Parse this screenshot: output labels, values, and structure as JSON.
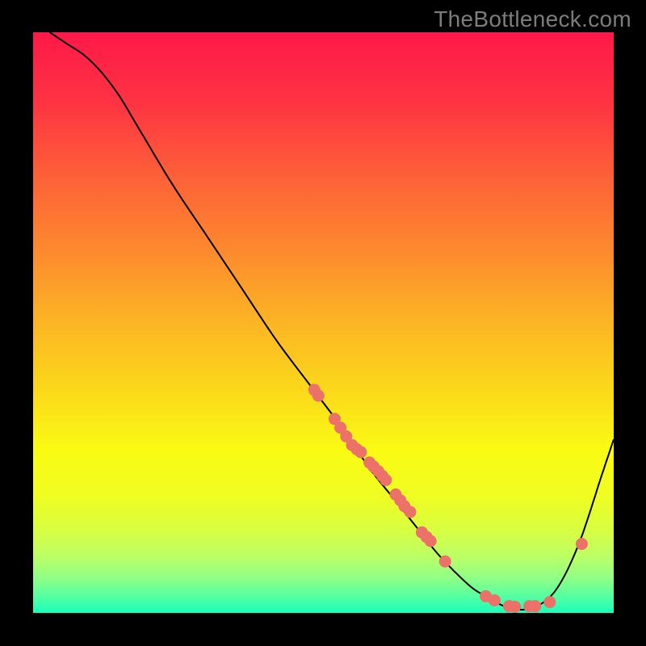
{
  "watermark": "TheBottleneck.com",
  "colors": {
    "curve": "#000000",
    "points": "#ec7168",
    "axis": "#000000"
  },
  "chart_data": {
    "type": "line",
    "title": "",
    "xlabel": "",
    "ylabel": "",
    "xlim": [
      0,
      100
    ],
    "ylim": [
      0,
      100
    ],
    "grid": false,
    "legend": false,
    "curve": {
      "x": [
        3,
        6,
        9,
        12,
        15,
        18,
        24,
        30,
        36,
        42,
        48,
        54,
        58,
        62,
        66,
        70,
        75,
        78,
        82,
        86,
        90,
        94,
        98,
        100
      ],
      "y": [
        100,
        98,
        96,
        93,
        89,
        84,
        74,
        65,
        56,
        47,
        39,
        31,
        25,
        20,
        15,
        10,
        5,
        3,
        1,
        1,
        4,
        12,
        24,
        30
      ]
    },
    "points": {
      "x": [
        48.5,
        49.2,
        52.0,
        53.0,
        54.0,
        55.0,
        55.8,
        56.5,
        58.0,
        58.7,
        59.5,
        60.2,
        60.8,
        62.5,
        63.3,
        64.0,
        65.0,
        67.0,
        67.8,
        68.5,
        71.0,
        78.0,
        79.5,
        82.0,
        83.0,
        85.5,
        86.5,
        89.0,
        94.5
      ],
      "y": [
        38.5,
        37.5,
        33.5,
        32.0,
        30.5,
        29.0,
        28.3,
        27.8,
        26.0,
        25.3,
        24.5,
        23.7,
        23.0,
        20.5,
        19.5,
        18.5,
        17.5,
        14.0,
        13.2,
        12.5,
        9.0,
        3.0,
        2.3,
        1.3,
        1.2,
        1.3,
        1.3,
        2.0,
        12.0
      ]
    },
    "background_gradient": {
      "type": "vertical",
      "stops": [
        {
          "pos": 0.0,
          "color": "#fe1948"
        },
        {
          "pos": 0.12,
          "color": "#fe3343"
        },
        {
          "pos": 0.25,
          "color": "#fd6138"
        },
        {
          "pos": 0.38,
          "color": "#fd8b2e"
        },
        {
          "pos": 0.5,
          "color": "#fcb524"
        },
        {
          "pos": 0.62,
          "color": "#fbda1a"
        },
        {
          "pos": 0.72,
          "color": "#fafb13"
        },
        {
          "pos": 0.8,
          "color": "#effd22"
        },
        {
          "pos": 0.86,
          "color": "#d6fe44"
        },
        {
          "pos": 0.9,
          "color": "#bdff64"
        },
        {
          "pos": 0.94,
          "color": "#8eff87"
        },
        {
          "pos": 0.97,
          "color": "#56ffa1"
        },
        {
          "pos": 1.0,
          "color": "#17ffbe"
        }
      ]
    }
  }
}
